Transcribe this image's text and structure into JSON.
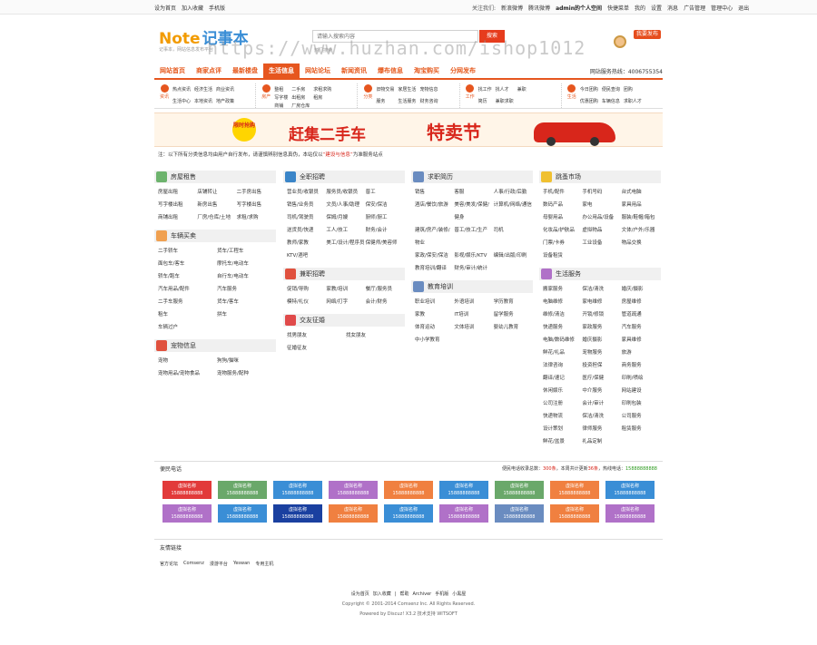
{
  "topbar": {
    "left": [
      "设为首页",
      "加入收藏",
      "手机版"
    ],
    "right_prefix": "关注我们:",
    "weibo": "新浪微博",
    "tweibo": "腾讯微博",
    "user": "admin的个人空间",
    "user_links": [
      "快捷菜单",
      "我的",
      "设置",
      "消息",
      "广告管理",
      "管理中心",
      "退出"
    ]
  },
  "header": {
    "logo_en": "Note",
    "logo_cn": "记事本",
    "slogan": "记事本，网站信息发布平台",
    "search_placeholder": "请输入搜索内容",
    "search_btn": "搜索",
    "hot": "热门搜索",
    "post_job": "我要发布"
  },
  "nav": {
    "items": [
      "网站首页",
      "商家点评",
      "最新楼盘",
      "生活信息",
      "网站论坛",
      "新闻资讯",
      "爆布信息",
      "淘宝购买",
      "分网发布"
    ],
    "active": 3,
    "hotline": "网站服务热线：4006755354"
  },
  "cats": [
    {
      "name": "资讯",
      "links": [
        "热点资讯",
        "经济生活",
        "商业资讯",
        "生活中心",
        "本地资讯",
        "地产政策"
      ]
    },
    {
      "name": "房产",
      "links": [
        "整租",
        "二手房",
        "求租求购",
        "写字楼",
        "出租房",
        "租房",
        "商铺",
        "厂房仓库"
      ]
    },
    {
      "name": "分类",
      "links": [
        "旧物交易",
        "家居生活",
        "宠物信息",
        "服务",
        "生活服务",
        "财务咨询"
      ]
    },
    {
      "name": "工作",
      "links": [
        "找工作",
        "找人才",
        "兼职",
        "简历",
        "兼职求职"
      ]
    },
    {
      "name": "生活",
      "links": [
        "今日团购",
        "便民查询",
        "团购",
        "优惠团购",
        "车辆信息",
        "求职人才"
      ]
    }
  ],
  "banner": {
    "badge": "限时抢购",
    "title": "赶集二手车",
    "title2": "特卖节"
  },
  "note": {
    "prefix": "注：",
    "text": "以下所有分类信息均由用户自行发布，请谨慎辨别信息真伪，本站仅以",
    "red": "“建设与信息”",
    "suffix": "为准服务站点"
  },
  "sections": [
    {
      "col": 0,
      "title": "房屋租售",
      "color": "#6db36d",
      "cols": 3,
      "links": [
        "房屋出租",
        "店铺转让",
        "二手房出售",
        "写字楼出租",
        "新房出售",
        "写字楼出售",
        "商铺出租",
        "厂房/仓库/土地",
        "求租/求购"
      ]
    },
    {
      "col": 0,
      "title": "车辆买卖",
      "color": "#f0a050",
      "cols": 2,
      "links": [
        "二手轿车",
        "货车/工程车",
        "面包车/客车",
        "摩托车/电动车",
        "轿车/跑车",
        "自行车/电动车",
        "汽车用品/配件",
        "汽车服务",
        "二手车服务",
        "货车/客车",
        "租车",
        "拼车",
        "车辆过户"
      ]
    },
    {
      "col": 0,
      "title": "宠物信息",
      "color": "#e0513e",
      "cols": 2,
      "links": [
        "宠物",
        "狗狗/猫咪",
        "宠物用品/宠物食品",
        "宠物服务/配种"
      ]
    },
    {
      "col": 1,
      "title": "全职招聘",
      "color": "#3a85c8",
      "cols": 3,
      "links": [
        "营业员/收银员",
        "服务员/收银员",
        "普工",
        "销售/业务员",
        "文员/人事/助理",
        "保安/保洁",
        "司机/驾驶员",
        "保姆/月嫂",
        "厨师/厨工",
        "送货员/快递",
        "工人/技工",
        "财务/会计",
        "教师/家教",
        "美工/设计/程序员",
        "保健师/美容师",
        "KTV/酒吧"
      ]
    },
    {
      "col": 1,
      "title": "兼职招聘",
      "color": "#e0513e",
      "cols": 3,
      "links": [
        "促销/导购",
        "家教/培训",
        "餐厅/服务员",
        "模特/礼仪",
        "网络/打字",
        "会计/财务"
      ]
    },
    {
      "col": 1,
      "title": "交友征婚",
      "color": "#e04a4a",
      "cols": 2,
      "links": [
        "找男朋友",
        "找女朋友",
        "征婚征友"
      ]
    },
    {
      "col": 2,
      "title": "求职简历",
      "color": "#6a8cc0",
      "cols": 3,
      "links": [
        "销售",
        "客服",
        "人事/行政/后勤",
        "酒店/餐饮/旅游",
        "美容/美发/保健/健身",
        "计算机/网络/通信",
        "建筑/房产/装修/物业",
        "普工/技工/生产",
        "司机",
        "家政/保安/保洁",
        "影视/娱乐/KTV",
        "编辑/出版/印刷",
        "教育培训/翻译",
        "财务/审计/统计"
      ]
    },
    {
      "col": 2,
      "title": "教育培训",
      "color": "#6a8cc0",
      "cols": 3,
      "links": [
        "职业培训",
        "外语培训",
        "学历教育",
        "家教",
        "IT培训",
        "留学服务",
        "体育运动",
        "文体培训",
        "婴幼儿教育",
        "中小学教育"
      ]
    },
    {
      "col": 3,
      "title": "跳蚤市场",
      "color": "#f0c030",
      "cols": 3,
      "links": [
        "手机/配件",
        "手机号码",
        "台式电脑",
        "数码产品",
        "家电",
        "家具用品",
        "母婴用品",
        "办公用品/设备",
        "服装/鞋帽/箱包",
        "化妆品/护肤品",
        "虚拟物品",
        "文体/户外/乐器",
        "门票/卡券",
        "工业设备",
        "物品交换",
        "设备租赁"
      ]
    },
    {
      "col": 3,
      "title": "生活服务",
      "color": "#b071c8",
      "cols": 3,
      "links": [
        "搬家服务",
        "保洁/清洗",
        "婚庆/摄影",
        "电脑维修",
        "家电维修",
        "房屋维修",
        "维修/清洁",
        "开锁/修锁",
        "管道疏通",
        "快递服务",
        "家政服务",
        "汽车服务",
        "电脑/数码维修",
        "婚庆摄影",
        "家具维修",
        "鲜花/礼品",
        "宠物服务",
        "旅游",
        "法律咨询",
        "投资担保",
        "商务服务",
        "翻译/速记",
        "医疗/保健",
        "印刷/喷绘",
        "休闲娱乐",
        "中介服务",
        "网站建设",
        "公司注册",
        "会计/审计",
        "印刷包装",
        "快递物流",
        "保洁/清洗",
        "公司服务",
        "设计策划",
        "律师服务",
        "租赁服务",
        "鲜花/盆景",
        "礼品定制"
      ]
    }
  ],
  "bianmin": {
    "title": "便民电话",
    "stat_prefix": "便民电话收录总数：",
    "count": "300条",
    "week_label": "，本周共计更新",
    "week": "36条",
    "phone_label": "，热线电话：",
    "phone": "15888888888",
    "item_name": "虚拟名称",
    "item_phone": "15888888888",
    "colors": [
      "#e23a3a",
      "#6aa86a",
      "#3a8ed6",
      "#b071c8",
      "#f08040",
      "#3a8ed6",
      "#6aa86a",
      "#f08040",
      "#3a8ed6",
      "#b071c8",
      "#3a8ed6",
      "#1a40a0",
      "#f08040",
      "#3a8ed6",
      "#b071c8",
      "#6a8cc0",
      "#f08040",
      "#b071c8"
    ]
  },
  "friend": {
    "title": "友情链接",
    "links": [
      "官方论坛",
      "Comsenz",
      "漫游平台",
      "Yeswan",
      "专用主机"
    ]
  },
  "footer": {
    "links": [
      "设为首页",
      "加入收藏",
      "|",
      "帮助",
      "Archiver",
      "手机版",
      "小黑屋"
    ],
    "copyright": "Copyright © 2001-2014 Comsenz Inc. All Rights Reserved.",
    "powered": "Powered by Discuz! X3.2 技术支持 WITSOFT"
  },
  "watermark": "https://www.huzhan.com/ishop1012"
}
